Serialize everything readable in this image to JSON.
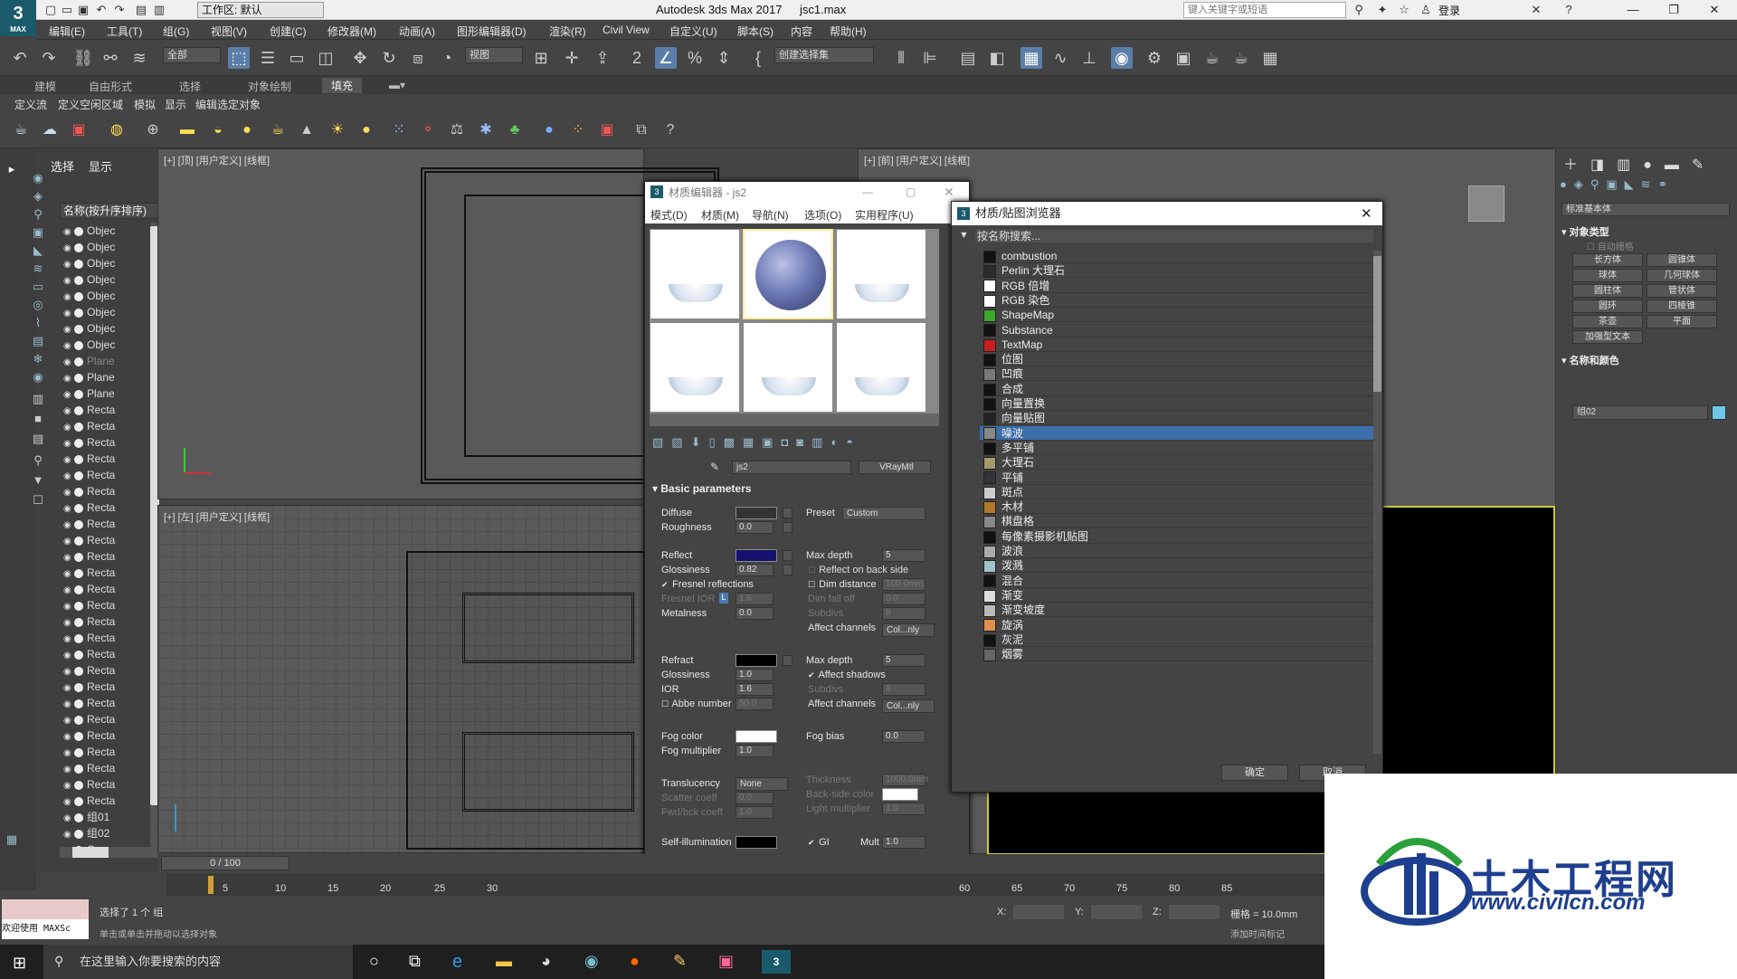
{
  "titlebar": {
    "workspace": "工作区: 默认",
    "app_title": "Autodesk 3ds Max 2017",
    "file_name": "jsc1.max",
    "search_placeholder": "键入关键字或短语",
    "login": "登录",
    "logo": "3",
    "logo_sub": "MAX"
  },
  "menubar": {
    "items": [
      "编辑(E)",
      "工具(T)",
      "组(G)",
      "视图(V)",
      "创建(C)",
      "修改器(M)",
      "动画(A)",
      "图形编辑器(D)",
      "渲染(R)",
      "Civil View",
      "自定义(U)",
      "脚本(S)",
      "内容",
      "帮助(H)"
    ]
  },
  "toolbar": {
    "filter_select": "全部",
    "view_select": "视图",
    "selection_set": "创建选择集",
    "snap_value": "2.5"
  },
  "ribbon": {
    "tabs": [
      "建模",
      "自由形式",
      "选择",
      "对象绘制",
      "填充"
    ],
    "active_tab": "填充",
    "subtabs": [
      "定义流",
      "定义空闲区域",
      "模拟",
      "显示",
      "编辑选定对象"
    ]
  },
  "scene": {
    "tabs": [
      "选择",
      "显示"
    ],
    "header": "名称(按升序排序)",
    "rows": [
      "Objec",
      "Objec",
      "Objec",
      "Objec",
      "Objec",
      "Objec",
      "Objec",
      "Objec",
      "Plane",
      "Plane",
      "Plane",
      "Recta",
      "Recta",
      "Recta",
      "Recta",
      "Recta",
      "Recta",
      "Recta",
      "Recta",
      "Recta",
      "Recta",
      "Recta",
      "Recta",
      "Recta",
      "Recta",
      "Recta",
      "Recta",
      "Recta",
      "Recta",
      "Recta",
      "Recta",
      "Recta",
      "Recta",
      "Recta",
      "Recta",
      "Recta",
      "组01",
      "组02",
      "Gr"
    ]
  },
  "viewports": {
    "top": "[+] [顶] [用户定义] [线框]",
    "front": "[+] [前] [用户定义] [线框]",
    "left": "[+] [左] [用户定义] [线框]"
  },
  "material_editor": {
    "title": "材质编辑器 - js2",
    "menu": [
      "模式(D)",
      "材质(M)",
      "导航(N)",
      "选项(O)",
      "实用程序(U)"
    ],
    "name": "js2",
    "type": "VRayMtl",
    "rollout": "Basic parameters",
    "diffuse": "Diffuse",
    "roughness": "Roughness",
    "roughness_val": "0.0",
    "preset": "Preset",
    "preset_val": "Custom",
    "reflect": "Reflect",
    "max_depth": "Max depth",
    "max_depth_val": "5",
    "glossiness": "Glossiness",
    "gloss_val": "0.82",
    "reflect_back": "Reflect on back side",
    "fresnel": "Fresnel reflections",
    "dim_distance": "Dim distance",
    "dim_val": "100.0mm",
    "fresnel_ior": "Fresnel IOR",
    "fresnel_l": "L",
    "fresnel_ior_val": "1.6",
    "dim_falloff": "Dim fall off",
    "dim_falloff_val": "0.0",
    "metalness": "Metalness",
    "metal_val": "0.0",
    "subdivs": "Subdivs",
    "subdivs_val": "8",
    "affect_channels": "Affect channels",
    "affect_val": "Col...nly",
    "refract": "Refract",
    "max_depth2_val": "5",
    "glossiness2_val": "1.0",
    "affect_shadows": "Affect shadows",
    "ior": "IOR",
    "ior_val": "1.6",
    "subdivs2_val": "8",
    "abbe": "Abbe number",
    "abbe_val": "50.0",
    "affect_val2": "Col...nly",
    "fog_color": "Fog color",
    "fog_bias": "Fog bias",
    "fog_bias_val": "0.0",
    "fog_mult": "Fog multiplier",
    "fog_mult_val": "1.0",
    "translucency": "Translucency",
    "transl_val": "None",
    "thickness": "Thickness",
    "thickness_val": "1000.0mm",
    "scatter": "Scatter coeff",
    "scatter_val": "0.0",
    "backside": "Back-side color",
    "fwd": "Fwd/bck coeff",
    "fwd_val": "1.0",
    "light_mult": "Light multiplier",
    "light_mult_val": "1.0",
    "self_illum": "Self-illumination",
    "gi": "GI",
    "mult": "Mult",
    "mult_val": "1.0",
    "colors": {
      "diffuse": "#333333",
      "reflect": "#14126e",
      "refract": "#000000",
      "fog": "#ffffff",
      "backside": "#ffffff"
    }
  },
  "map_browser": {
    "title": "材质/贴图浏览器",
    "search": "按名称搜索...",
    "items": [
      {
        "name": "combustion",
        "color": "#111111"
      },
      {
        "name": "Perlin 大理石",
        "color": "#2b2b2b"
      },
      {
        "name": "RGB 倍增",
        "color": "#ffffff"
      },
      {
        "name": "RGB 染色",
        "color": "#ffffff"
      },
      {
        "name": "ShapeMap",
        "color": "#3ca82c"
      },
      {
        "name": "Substance",
        "color": "#111111"
      },
      {
        "name": "TextMap",
        "color": "#c81e1e"
      },
      {
        "name": "位图",
        "color": "#111111"
      },
      {
        "name": "凹痕",
        "color": "#777777"
      },
      {
        "name": "合成",
        "color": "#111111"
      },
      {
        "name": "向量置换",
        "color": "#111111"
      },
      {
        "name": "向量贴图",
        "color": "#222222"
      },
      {
        "name": "噪波",
        "color": "#888888"
      },
      {
        "name": "多平铺",
        "color": "#111111"
      },
      {
        "name": "大理石",
        "color": "#a59b6a"
      },
      {
        "name": "平铺",
        "color": "#333333"
      },
      {
        "name": "斑点",
        "color": "#cccccc"
      },
      {
        "name": "木材",
        "color": "#b07a2a"
      },
      {
        "name": "棋盘格",
        "color": "#888888"
      },
      {
        "name": "每像素摄影机贴图",
        "color": "#111111"
      },
      {
        "name": "波浪",
        "color": "#aaaaaa"
      },
      {
        "name": "泼溅",
        "color": "#9ec3c8"
      },
      {
        "name": "混合",
        "color": "#111111"
      },
      {
        "name": "渐变",
        "color": "#dddddd"
      },
      {
        "name": "渐变坡度",
        "color": "#bbbbbb"
      },
      {
        "name": "旋涡",
        "color": "#e0904a"
      },
      {
        "name": "灰泥",
        "color": "#111111"
      },
      {
        "name": "烟雾",
        "color": "#666666"
      }
    ],
    "selected": "噪波",
    "ok": "确定",
    "cancel": "取消"
  },
  "command_panel": {
    "select": "标准基本体",
    "rollout_type": "对象类型",
    "autogrid": "自动栅格",
    "buttons": [
      "长方体",
      "圆锥体",
      "球体",
      "几何球体",
      "圆柱体",
      "管状体",
      "圆环",
      "四棱锥",
      "茶壶",
      "平面",
      "加强型文本"
    ],
    "rollout_name": "名称和颜色",
    "name_val": "组02"
  },
  "timeline": {
    "frame": "0 / 100",
    "ticks": [
      "5",
      "10",
      "15",
      "20",
      "25",
      "30",
      "60",
      "65",
      "70",
      "75",
      "80",
      "85"
    ]
  },
  "status": {
    "welcome": "欢迎使用 MAXSc",
    "selected": "选择了 1 个 组",
    "hint": "单击或单击并拖动以选择对象",
    "x": "X:",
    "y": "Y:",
    "z": "Z:",
    "grid": "栅格 = 10.0mm",
    "add_tag": "添加时间标记"
  },
  "taskbar": {
    "search": "在这里输入你要搜索的内容"
  },
  "watermark": {
    "title": "土木工程网",
    "url": "www.civilcn.com"
  }
}
